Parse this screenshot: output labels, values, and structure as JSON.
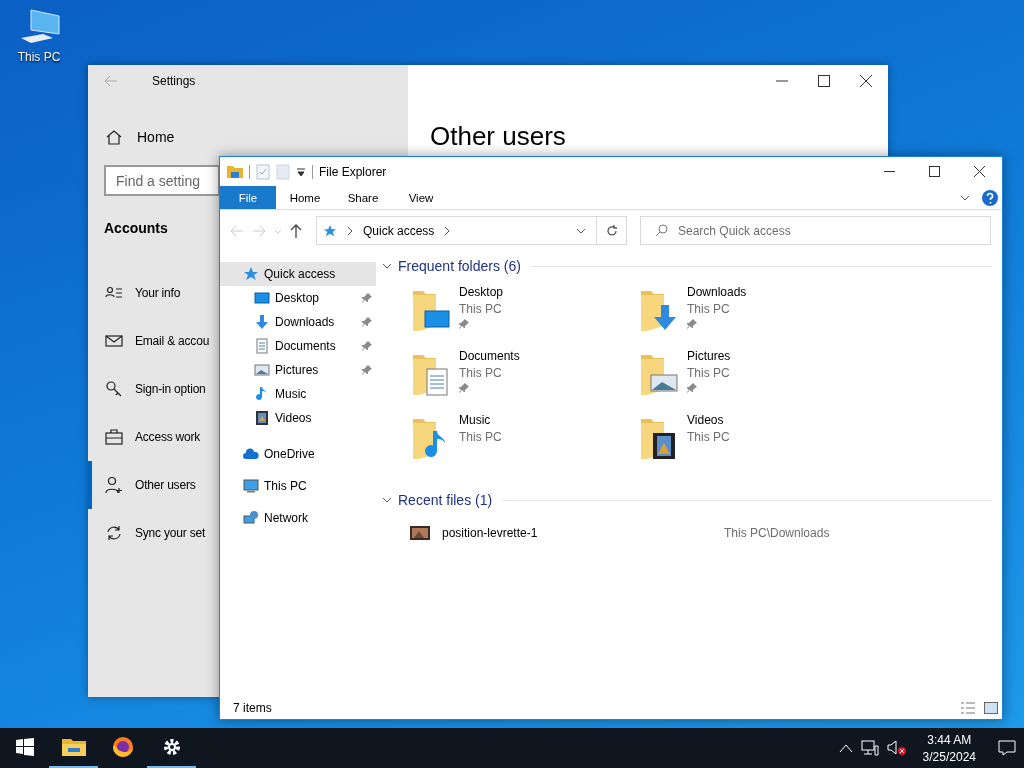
{
  "desktop_icons": [
    {
      "label": "This PC"
    }
  ],
  "settings": {
    "title": "Settings",
    "home": "Home",
    "search": {
      "placeholder": "Find a setting"
    },
    "section": "Accounts",
    "items": [
      {
        "label": "Your info",
        "kind": "info",
        "selected": false
      },
      {
        "label": "Email & accou",
        "kind": "mail",
        "selected": false
      },
      {
        "label": "Sign-in option",
        "kind": "key",
        "selected": false
      },
      {
        "label": "Access work",
        "kind": "work",
        "selected": false
      },
      {
        "label": "Other users",
        "kind": "users",
        "selected": true
      },
      {
        "label": "Sync your set",
        "kind": "sync",
        "selected": false
      }
    ],
    "page_title": "Other users"
  },
  "explorer": {
    "title": "File Explorer",
    "ribbon_tabs": [
      {
        "label": "File",
        "kind": "file"
      },
      {
        "label": "Home",
        "kind": "tab"
      },
      {
        "label": "Share",
        "kind": "tab"
      },
      {
        "label": "View",
        "kind": "tab"
      }
    ],
    "address": {
      "path": "Quick access"
    },
    "search": {
      "placeholder": "Search Quick access"
    },
    "nav_pane": [
      {
        "label": "Quick access",
        "kind": "star",
        "selected": true,
        "children": [
          {
            "label": "Desktop",
            "kind": "desktop",
            "pinned": true,
            "selected": false
          },
          {
            "label": "Downloads",
            "kind": "downloads",
            "pinned": true,
            "selected": false
          },
          {
            "label": "Documents",
            "kind": "documents",
            "pinned": true,
            "selected": false
          },
          {
            "label": "Pictures",
            "kind": "pictures",
            "pinned": true,
            "selected": false
          },
          {
            "label": "Music",
            "kind": "music",
            "pinned": false,
            "selected": false
          },
          {
            "label": "Videos",
            "kind": "videos",
            "pinned": false,
            "selected": false
          }
        ]
      },
      {
        "label": "OneDrive",
        "kind": "onedrive",
        "selected": false
      },
      {
        "label": "This PC",
        "kind": "pc",
        "selected": false
      },
      {
        "label": "Network",
        "kind": "network",
        "selected": false
      }
    ],
    "frequent_folders": {
      "title": "Frequent folders (6)",
      "expanded": true,
      "items": [
        {
          "name": "Desktop",
          "location": "This PC",
          "kind": "desktop",
          "pinned": true
        },
        {
          "name": "Downloads",
          "location": "This PC",
          "kind": "downloads",
          "pinned": true
        },
        {
          "name": "Documents",
          "location": "This PC",
          "kind": "documents",
          "pinned": true
        },
        {
          "name": "Pictures",
          "location": "This PC",
          "kind": "pictures",
          "pinned": true
        },
        {
          "name": "Music",
          "location": "This PC",
          "kind": "music",
          "pinned": false
        },
        {
          "name": "Videos",
          "location": "This PC",
          "kind": "videos",
          "pinned": false
        }
      ]
    },
    "recent_files": {
      "title": "Recent files (1)",
      "expanded": true,
      "items": [
        {
          "name": "position-levrette-1",
          "path": "This PC\\Downloads"
        }
      ]
    },
    "status": "7 items"
  },
  "taskbar": {
    "apps": [
      {
        "kind": "start",
        "open": false
      },
      {
        "kind": "explorer",
        "open": true
      },
      {
        "kind": "firefox",
        "open": false
      },
      {
        "kind": "settings",
        "open": true
      }
    ],
    "time": "3:44 AM",
    "date": "3/25/2024"
  }
}
